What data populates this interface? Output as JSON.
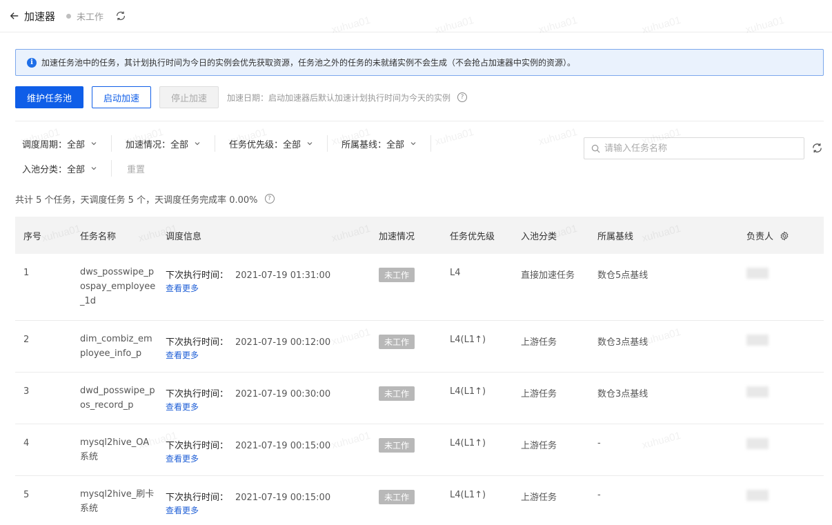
{
  "header": {
    "title": "加速器",
    "status": "未工作"
  },
  "alert": {
    "text": "加速任务池中的任务，其计划执行时间为今日的实例会优先获取资源，任务池之外的任务的未就绪实例不会生成（不会抢占加速器中实例的资源）。"
  },
  "actions": {
    "maintain": "维护任务池",
    "start": "启动加速",
    "stop": "停止加速",
    "hint": "加速日期：启动加速器后默认加速计划执行时间为今天的实例"
  },
  "filters": {
    "cycle": "调度周期：全部",
    "accel": "加速情况：全部",
    "priority": "任务优先级：全部",
    "baseline": "所属基线：全部",
    "pool": "入池分类：全部",
    "reset": "重置",
    "search_placeholder": "请输入任务名称"
  },
  "summary": {
    "text": "共计 5 个任务，天调度任务 5 个，天调度任务完成率 0.00%"
  },
  "table": {
    "headers": [
      "序号",
      "任务名称",
      "调度信息",
      "加速情况",
      "任务优先级",
      "入池分类",
      "所属基线",
      "负责人"
    ],
    "rows": [
      {
        "idx": "1",
        "name": "dws_posswipe_pospay_employee_1d",
        "sched_label": "下次执行时间：",
        "sched_time": "2021-07-19 01:31:00",
        "more": "查看更多",
        "accel": "未工作",
        "priority": "L4",
        "pool": "直接加速任务",
        "baseline": "数仓5点基线"
      },
      {
        "idx": "2",
        "name": "dim_combiz_employee_info_p",
        "sched_label": "下次执行时间：",
        "sched_time": "2021-07-19 00:12:00",
        "more": "查看更多",
        "accel": "未工作",
        "priority": "L4(L1↑)",
        "pool": "上游任务",
        "baseline": "数仓3点基线"
      },
      {
        "idx": "3",
        "name": "dwd_posswipe_pos_record_p",
        "sched_label": "下次执行时间：",
        "sched_time": "2021-07-19 00:30:00",
        "more": "查看更多",
        "accel": "未工作",
        "priority": "L4(L1↑)",
        "pool": "上游任务",
        "baseline": "数仓3点基线"
      },
      {
        "idx": "4",
        "name": "mysql2hive_OA系统",
        "sched_label": "下次执行时间：",
        "sched_time": "2021-07-19 00:15:00",
        "more": "查看更多",
        "accel": "未工作",
        "priority": "L4(L1↑)",
        "pool": "上游任务",
        "baseline": "-"
      },
      {
        "idx": "5",
        "name": "mysql2hive_刷卡系统",
        "sched_label": "下次执行时间：",
        "sched_time": "2021-07-19 00:15:00",
        "more": "查看更多",
        "accel": "未工作",
        "priority": "L4(L1↑)",
        "pool": "上游任务",
        "baseline": "-"
      }
    ]
  },
  "watermark": "xuhua01"
}
